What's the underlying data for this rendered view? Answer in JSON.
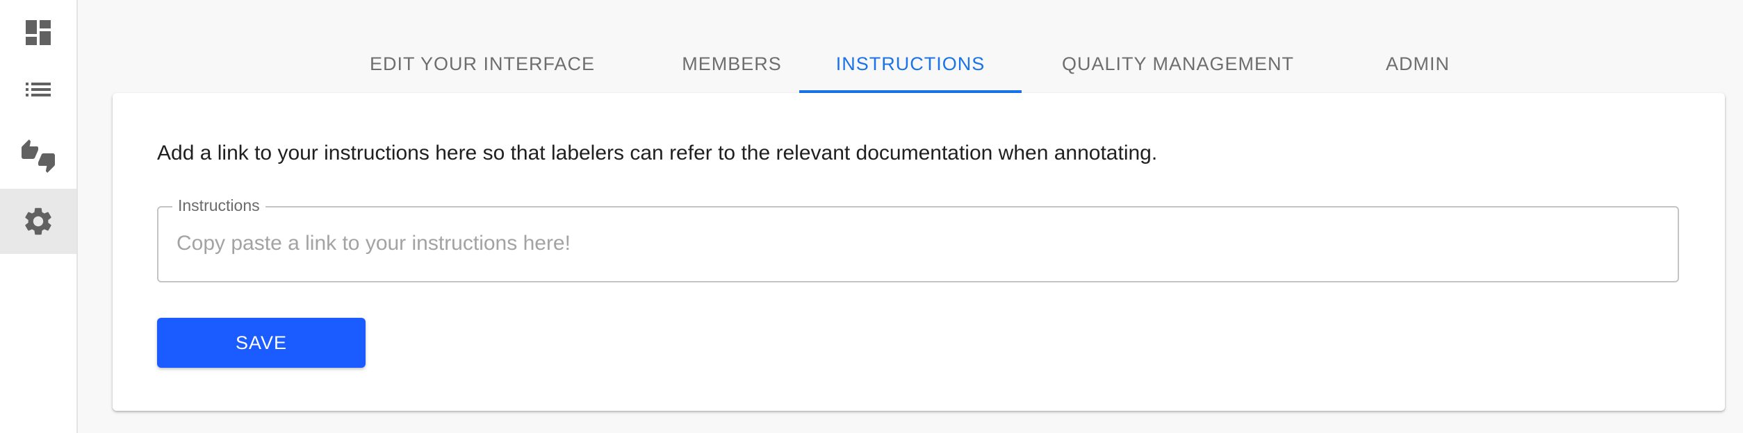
{
  "sidebar": {
    "items": [
      {
        "icon": "dashboard-icon",
        "active": false
      },
      {
        "icon": "list-icon",
        "active": false
      },
      {
        "icon": "thumbs-up-down-icon",
        "active": false
      },
      {
        "icon": "settings-gear-icon",
        "active": true
      }
    ]
  },
  "tabs": [
    {
      "label": "EDIT YOUR INTERFACE",
      "active": false
    },
    {
      "label": "MEMBERS",
      "active": false
    },
    {
      "label": "INSTRUCTIONS",
      "active": true
    },
    {
      "label": "QUALITY MANAGEMENT",
      "active": false
    },
    {
      "label": "ADMIN",
      "active": false
    }
  ],
  "card": {
    "description": "Add a link to your instructions here so that labelers can refer to the relevant documentation when annotating.",
    "instructions_field": {
      "label": "Instructions",
      "placeholder": "Copy paste a link to your instructions here!",
      "value": ""
    },
    "save_label": "SAVE"
  },
  "colors": {
    "accent": "#1a73e8",
    "button": "#1a5cff",
    "icon": "#616161"
  }
}
